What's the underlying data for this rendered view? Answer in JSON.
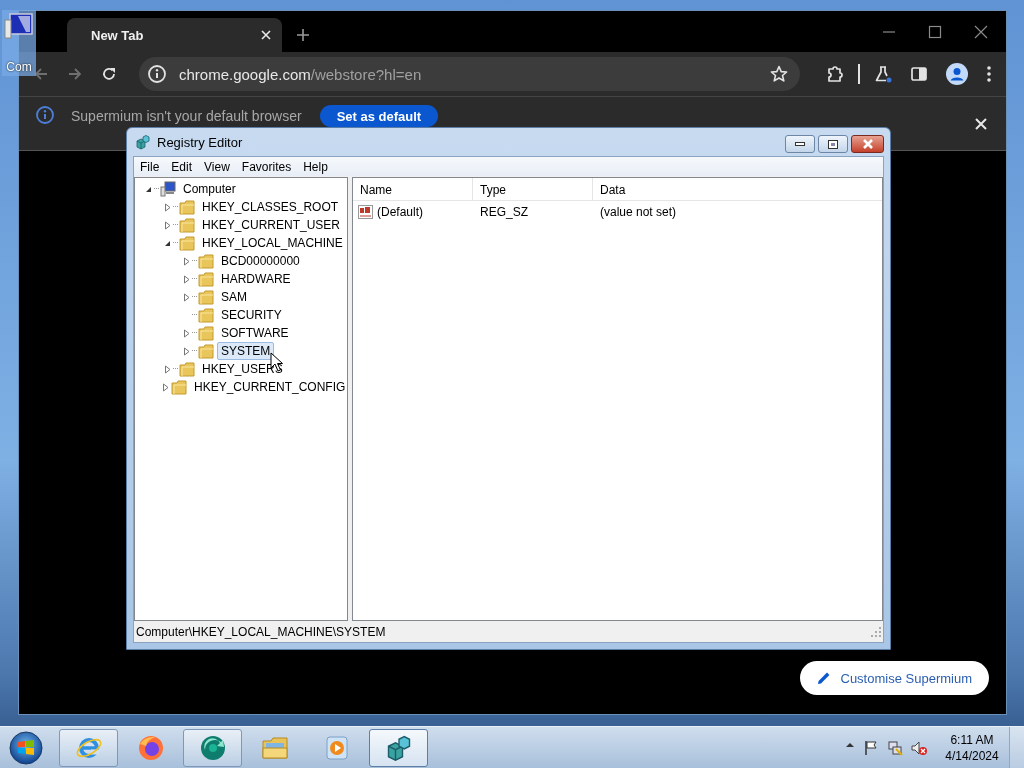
{
  "desktop": {
    "icons": [
      {
        "label": "Com",
        "selected": true
      }
    ]
  },
  "browser": {
    "tabs": [
      {
        "title": "New Tab",
        "selected": true
      }
    ],
    "address": {
      "host": "chrome.google.com",
      "path": "/webstore?hl=en"
    },
    "infobar": {
      "message": "Supermium isn't your default browser",
      "button": "Set as default"
    },
    "customise_button": "Customise Supermium"
  },
  "regedit": {
    "title": "Registry Editor",
    "menu": [
      "File",
      "Edit",
      "View",
      "Favorites",
      "Help"
    ],
    "tree": [
      {
        "label": "Computer",
        "kind": "computer",
        "expandable": true,
        "expanded": true,
        "selected": false,
        "children": [
          {
            "label": "HKEY_CLASSES_ROOT",
            "kind": "folder",
            "expandable": true,
            "expanded": false,
            "selected": false
          },
          {
            "label": "HKEY_CURRENT_USER",
            "kind": "folder",
            "expandable": true,
            "expanded": false,
            "selected": false
          },
          {
            "label": "HKEY_LOCAL_MACHINE",
            "kind": "folder",
            "expandable": true,
            "expanded": true,
            "selected": false,
            "children": [
              {
                "label": "BCD00000000",
                "kind": "folder",
                "expandable": true,
                "expanded": false,
                "selected": false
              },
              {
                "label": "HARDWARE",
                "kind": "folder",
                "expandable": true,
                "expanded": false,
                "selected": false
              },
              {
                "label": "SAM",
                "kind": "folder",
                "expandable": true,
                "expanded": false,
                "selected": false
              },
              {
                "label": "SECURITY",
                "kind": "folder",
                "expandable": false,
                "selected": false
              },
              {
                "label": "SOFTWARE",
                "kind": "folder",
                "expandable": true,
                "expanded": false,
                "selected": false
              },
              {
                "label": "SYSTEM",
                "kind": "folder",
                "expandable": true,
                "expanded": false,
                "selected": true
              }
            ]
          },
          {
            "label": "HKEY_USERS",
            "kind": "folder",
            "expandable": true,
            "expanded": false,
            "selected": false
          },
          {
            "label": "HKEY_CURRENT_CONFIG",
            "kind": "folder",
            "expandable": true,
            "expanded": false,
            "selected": false
          }
        ]
      }
    ],
    "list": {
      "columns": [
        "Name",
        "Type",
        "Data"
      ],
      "rows": [
        {
          "name": "(Default)",
          "type": "REG_SZ",
          "data": "(value not set)"
        }
      ]
    },
    "status_bar": "Computer\\HKEY_LOCAL_MACHINE\\SYSTEM"
  },
  "taskbar": {
    "buttons": [
      {
        "kind": "ie",
        "running": true,
        "selected": false
      },
      {
        "kind": "firefox",
        "running": false,
        "selected": false
      },
      {
        "kind": "swirl",
        "running": true,
        "selected": false
      },
      {
        "kind": "folder",
        "running": false,
        "selected": false
      },
      {
        "kind": "media",
        "running": false,
        "selected": false
      },
      {
        "kind": "registry",
        "running": true,
        "selected": true
      }
    ],
    "tray": [
      {
        "kind": "show-hidden"
      },
      {
        "kind": "flag"
      },
      {
        "kind": "network"
      },
      {
        "kind": "volume-muted"
      }
    ],
    "clock": {
      "time": "6:11 AM",
      "date": "4/14/2024"
    }
  }
}
